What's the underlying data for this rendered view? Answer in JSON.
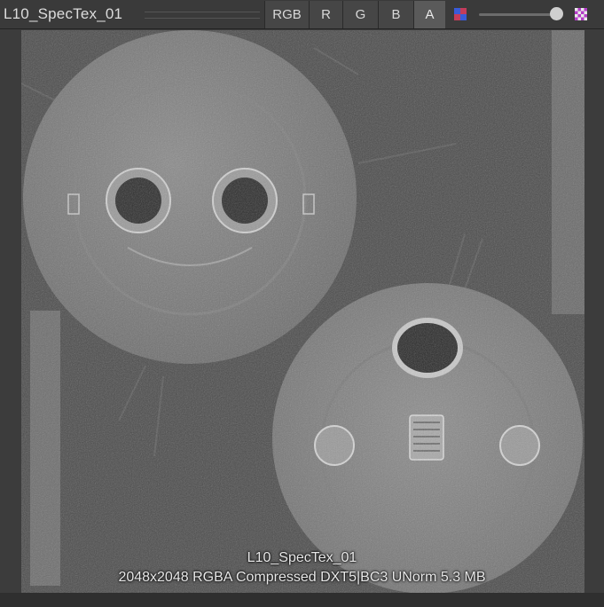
{
  "toolbar": {
    "title": "L10_SpecTex_01",
    "channels": [
      "RGB",
      "R",
      "G",
      "B",
      "A"
    ],
    "active_channel": "A",
    "mip_slider_value": 0.9
  },
  "info": {
    "name": "L10_SpecTex_01",
    "details": "2048x2048  RGBA Compressed DXT5|BC3 UNorm   5.3 MB"
  },
  "colors": {
    "toolbar_bg": "#3a3a3a",
    "active_button": "#5a5a5a"
  },
  "icons": [
    "color-swatch-icon",
    "alpha-checker-icon"
  ]
}
